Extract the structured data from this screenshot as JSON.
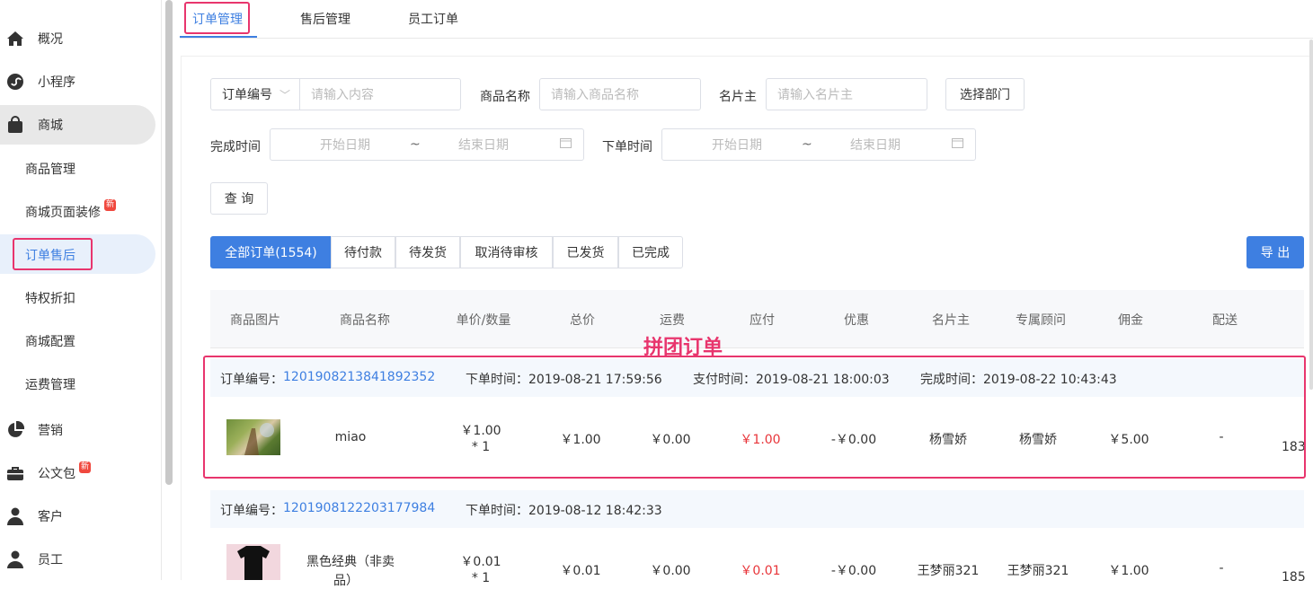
{
  "sidebar": {
    "items": [
      {
        "label": "概况",
        "icon": "home-icon"
      },
      {
        "label": "小程序",
        "icon": "mini-program-icon"
      },
      {
        "label": "商城",
        "icon": "shopping-bag-icon"
      },
      {
        "label": "营销",
        "icon": "pie-chart-icon"
      },
      {
        "label": "公文包",
        "icon": "briefcase-icon"
      },
      {
        "label": "客户",
        "icon": "user-icon"
      },
      {
        "label": "员工",
        "icon": "person-icon"
      }
    ],
    "subitems": [
      {
        "label": "商品管理"
      },
      {
        "label": "商城页面装修",
        "badge": "新"
      },
      {
        "label": "订单售后"
      },
      {
        "label": "特权折扣"
      },
      {
        "label": "商城配置"
      },
      {
        "label": "运费管理"
      }
    ],
    "briefcase_badge": "新"
  },
  "tabs": [
    "订单管理",
    "售后管理",
    "员工订单"
  ],
  "filters": {
    "order_type": "订单编号",
    "content_placeholder": "请输入内容",
    "product_label": "商品名称",
    "product_placeholder": "请输入商品名称",
    "card_label": "名片主",
    "card_placeholder": "请输入名片主",
    "dept_button": "选择部门",
    "finish_label": "完成时间",
    "order_time_label": "下单时间",
    "start_date": "开始日期",
    "end_date": "结束日期",
    "range_sep": "~",
    "query_button": "查 询"
  },
  "status_tabs": [
    "全部订单(1554)",
    "待付款",
    "待发货",
    "取消待审核",
    "已发货",
    "已完成"
  ],
  "export_button": "导 出",
  "columns": [
    "商品图片",
    "商品名称",
    "单价/数量",
    "总价",
    "运费",
    "应付",
    "优惠",
    "名片主",
    "专属顾问",
    "佣金",
    "配送"
  ],
  "annotation": "拼团订单",
  "orders": [
    {
      "no_label": "订单编号：",
      "no": "1201908213841892352",
      "order_time": "下单时间：2019-08-21 17:59:56",
      "pay_time": "支付时间：2019-08-21 18:00:03",
      "finish_time": "完成时间：2019-08-22 10:43:43",
      "name": "miao",
      "price": "￥1.00",
      "qty": "* 1",
      "total": "￥1.00",
      "freight": "￥0.00",
      "payable": "￥1.00",
      "discount": "-￥0.00",
      "owner": "杨雪娇",
      "advisor": "杨雪娇",
      "commission": "￥5.00",
      "delivery": "-",
      "extra": "183"
    },
    {
      "no_label": "订单编号：",
      "no": "1201908122203177984",
      "order_time": "下单时间：2019-08-12 18:42:33",
      "name": "黑色经典（非卖品）",
      "name1": "黑色经典（非卖",
      "name2": "品）",
      "price": "￥0.01",
      "qty": "* 1",
      "total": "￥0.01",
      "freight": "￥0.00",
      "payable": "￥0.01",
      "discount": "-￥0.00",
      "owner": "王梦丽321",
      "advisor": "王梦丽321",
      "commission": "￥1.00",
      "delivery": "-",
      "extra": "185"
    }
  ],
  "colors": {
    "accent": "#3e7fe1",
    "highlight": "#e8356d",
    "price_red": "#e8353a"
  }
}
